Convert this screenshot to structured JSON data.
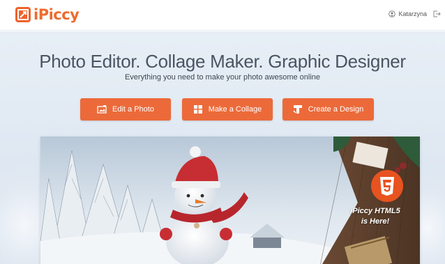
{
  "app": {
    "logo_text": "iPiccy",
    "brand_color": "#ef6a2d"
  },
  "header": {
    "user_name": "Katarzyna",
    "user_icon": "user-icon",
    "logout_icon": "logout-icon"
  },
  "hero": {
    "headline": "Photo Editor. Collage Maker. Graphic Designer",
    "subline": "Everything you need to make your photo awesome online",
    "buttons": [
      {
        "label": "Edit a Photo",
        "icon": "photo-edit-icon"
      },
      {
        "label": "Make a Collage",
        "icon": "collage-icon"
      },
      {
        "label": "Create a Design",
        "icon": "design-icon"
      }
    ],
    "button_color": "#ec6a3a"
  },
  "banner": {
    "badge_icon": "html5-icon",
    "badge_line1": "iPiccy HTML5",
    "badge_line2": "is Here!"
  }
}
